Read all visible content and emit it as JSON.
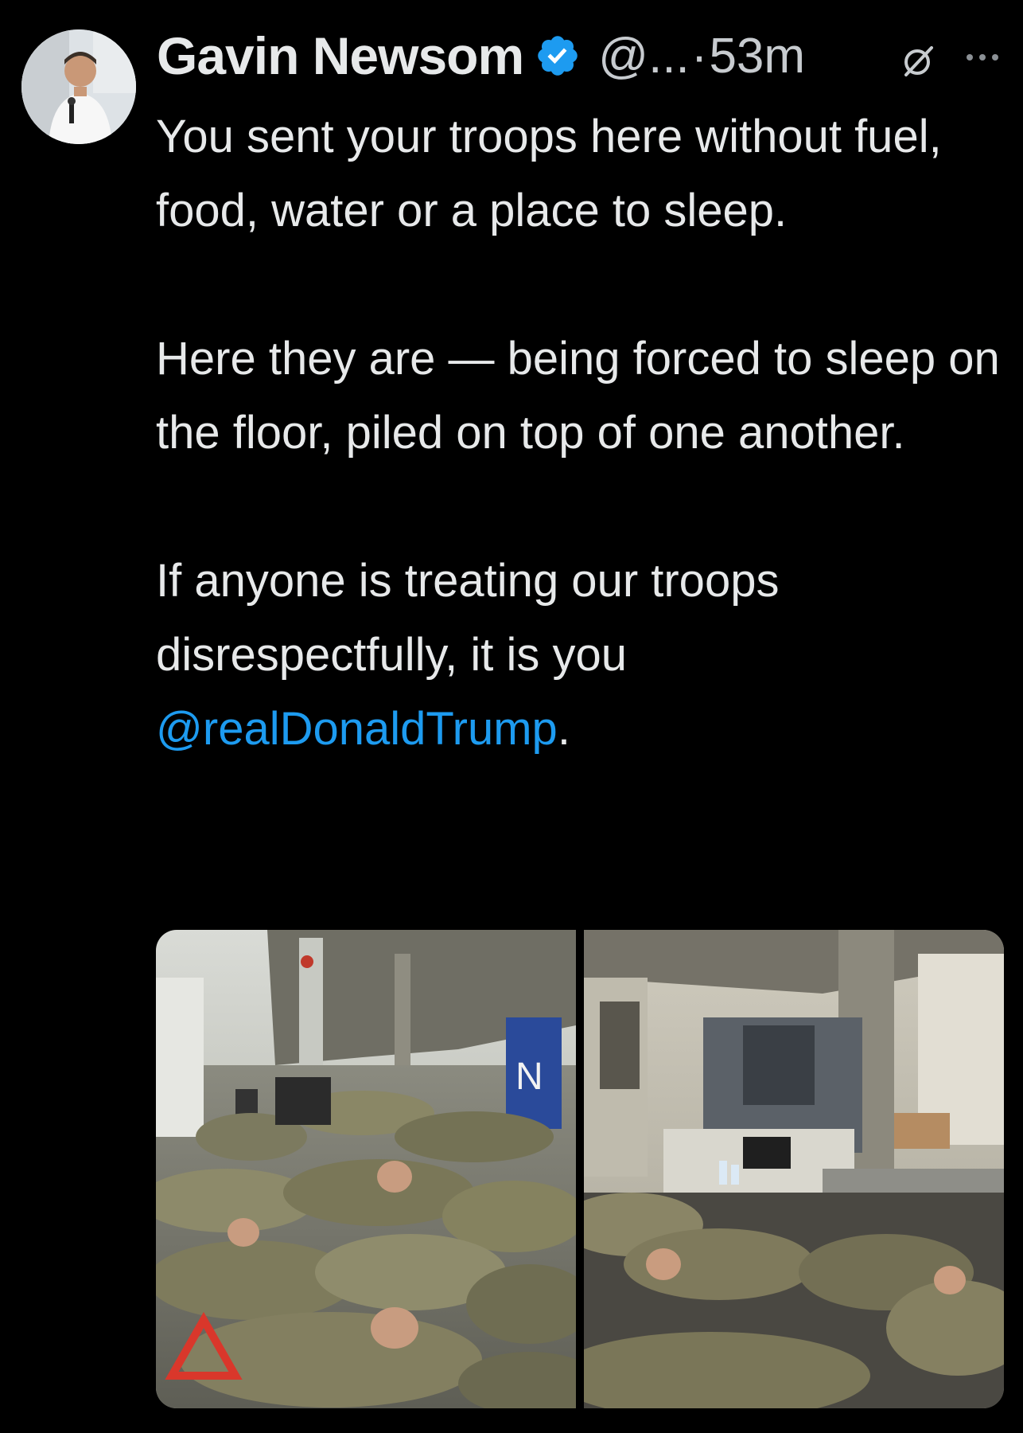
{
  "tweet": {
    "author_name": "Gavin Newsom",
    "handle": "@...",
    "separator": "·",
    "time": "53m",
    "paragraphs": [
      "You sent your troops here without fuel, food, water or a place to sleep.",
      "Here they are — being forced to sleep on the floor, piled on top of one another.",
      "If anyone is treating our troops disrespectfully, it is you"
    ],
    "mention": "@realDonaldTrump",
    "mention_suffix": "."
  },
  "icons": {
    "verified": "verified-badge-icon",
    "grok": "grok-icon",
    "more": "more-options-icon",
    "warning_triangle": "warning-triangle-icon"
  },
  "colors": {
    "background": "#000000",
    "text": "#e7e9ea",
    "secondary_text": "#c7cbcf",
    "link": "#1d9bf0",
    "verified_badge": "#1d9bf0"
  },
  "media": {
    "left_photo_sign": "N"
  }
}
